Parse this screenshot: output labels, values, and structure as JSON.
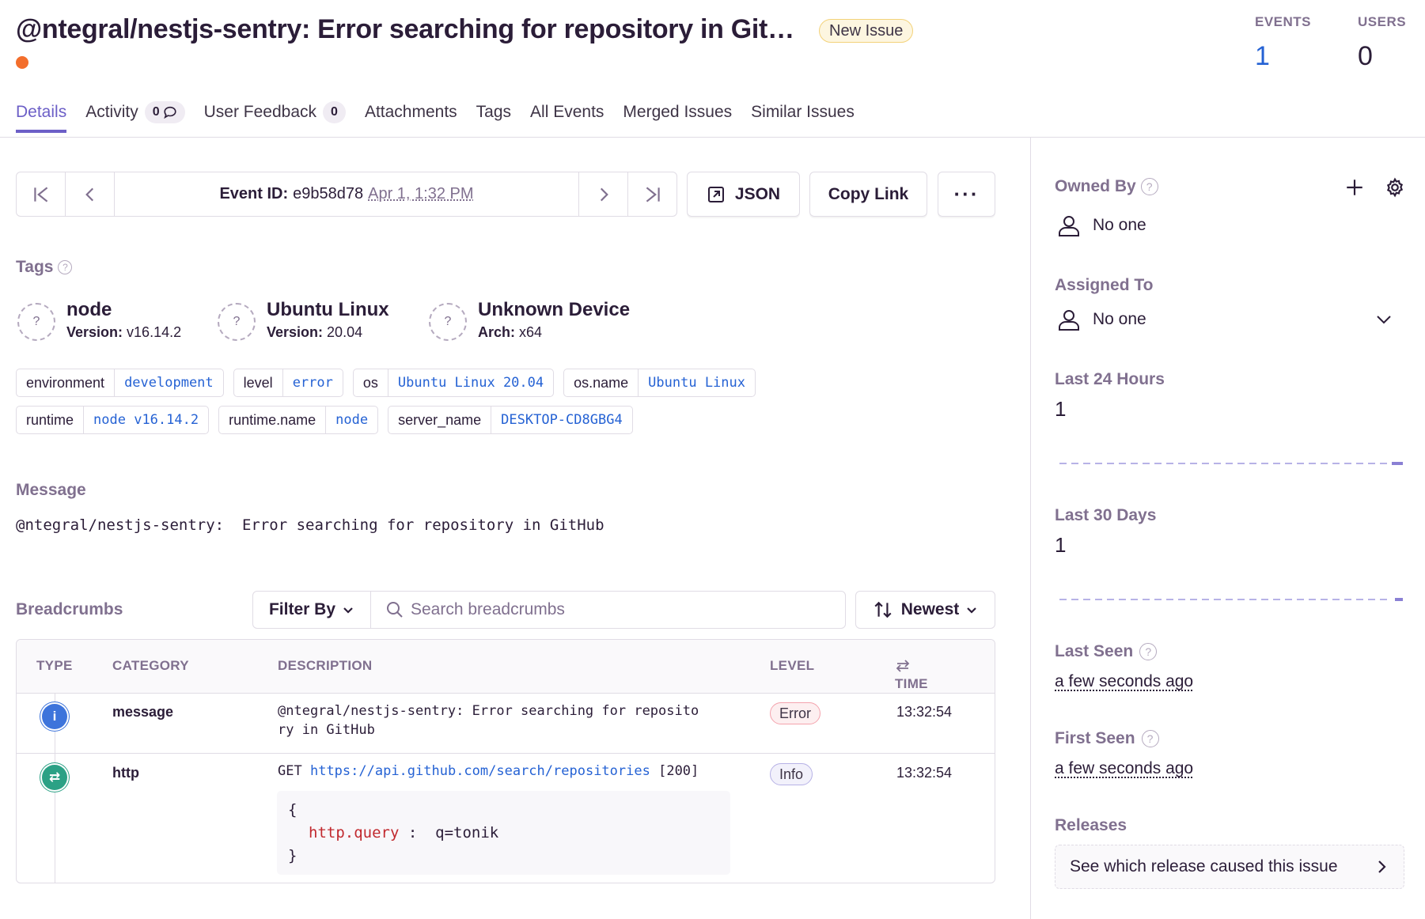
{
  "header": {
    "title": "@ntegral/nestjs-sentry: Error searching for repository in Git…",
    "badge": "New Issue",
    "events_label": "EVENTS",
    "events_value": "1",
    "users_label": "USERS",
    "users_value": "0",
    "status_color": "#f36e2c"
  },
  "tabs": [
    {
      "label": "Details",
      "active": true
    },
    {
      "label": "Activity",
      "count": "0"
    },
    {
      "label": "User Feedback",
      "count": "0"
    },
    {
      "label": "Attachments"
    },
    {
      "label": "Tags"
    },
    {
      "label": "All Events"
    },
    {
      "label": "Merged Issues"
    },
    {
      "label": "Similar Issues"
    }
  ],
  "event_nav": {
    "event_id_label": "Event ID:",
    "event_id": "e9b58d78",
    "date": "Apr 1, 1:32 PM",
    "json_label": "JSON",
    "copy_link_label": "Copy Link",
    "more_label": "···"
  },
  "tags_section": {
    "title": "Tags",
    "contexts": [
      {
        "name": "node",
        "sub_key": "Version:",
        "sub_val": "v16.14.2"
      },
      {
        "name": "Ubuntu Linux",
        "sub_key": "Version:",
        "sub_val": "20.04"
      },
      {
        "name": "Unknown Device",
        "sub_key": "Arch:",
        "sub_val": "x64"
      }
    ],
    "tags": [
      {
        "key": "environment",
        "value": "development"
      },
      {
        "key": "level",
        "value": "error"
      },
      {
        "key": "os",
        "value": "Ubuntu Linux 20.04"
      },
      {
        "key": "os.name",
        "value": "Ubuntu Linux"
      },
      {
        "key": "runtime",
        "value": "node v16.14.2"
      },
      {
        "key": "runtime.name",
        "value": "node"
      },
      {
        "key": "server_name",
        "value": "DESKTOP-CD8GBG4"
      }
    ]
  },
  "message_section": {
    "title": "Message",
    "text": "@ntegral/nestjs-sentry:  Error searching for repository in GitHub"
  },
  "breadcrumbs": {
    "title": "Breadcrumbs",
    "filter_label": "Filter By",
    "search_placeholder": "Search breadcrumbs",
    "sort_label": "Newest",
    "columns": {
      "type": "TYPE",
      "category": "CATEGORY",
      "description": "DESCRIPTION",
      "level": "LEVEL",
      "time": "TIME"
    },
    "rows": [
      {
        "type": "info",
        "category": "message",
        "description_line1": "@ntegral/nestjs-sentry:  Error searching for reposito",
        "description_line2": "ry in GitHub",
        "level": "Error",
        "time": "13:32:54"
      },
      {
        "type": "http",
        "category": "http",
        "method": "GET",
        "url": "https://api.github.com/search/repositories",
        "status": "[200]",
        "code_open": "{",
        "code_key": "http.query",
        "code_sep": " :  ",
        "code_val": "q=tonik",
        "code_close": "}",
        "level": "Info",
        "time": "13:32:54"
      }
    ]
  },
  "sidebar": {
    "owned_by_title": "Owned By",
    "owned_by_value": "No one",
    "assigned_to_title": "Assigned To",
    "assigned_to_value": "No one",
    "last24_title": "Last 24 Hours",
    "last24_value": "1",
    "last30_title": "Last 30 Days",
    "last30_value": "1",
    "last_seen_title": "Last Seen",
    "last_seen_value": "a few seconds ago",
    "first_seen_title": "First Seen",
    "first_seen_value": "a few seconds ago",
    "releases_title": "Releases",
    "releases_cta": "See which release caused this issue",
    "accent_color": "#6c5fc7"
  }
}
